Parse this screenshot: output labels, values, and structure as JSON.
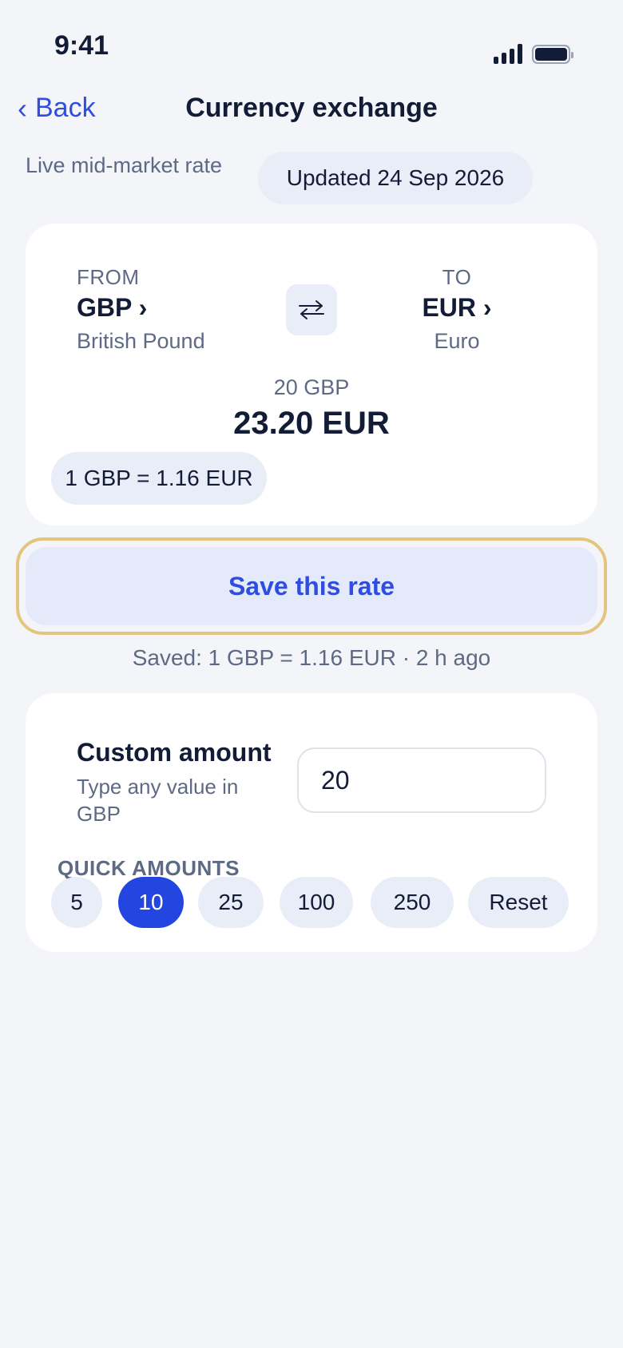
{
  "status_bar": {
    "time": "9:41"
  },
  "nav": {
    "back_label": "Back",
    "title": "Currency exchange"
  },
  "rate_info": {
    "label": "Live mid-market rate",
    "updated": "Updated 24 Sep 2026"
  },
  "converter": {
    "from": {
      "caption": "FROM",
      "code": "GBP ›",
      "name": "British Pound"
    },
    "to": {
      "caption": "TO",
      "code": "EUR ›",
      "name": "Euro"
    },
    "swap_icon": "swap-arrows-icon",
    "source_amount": "20 GBP",
    "result_amount": "23.20 EUR",
    "rate": "1 GBP = 1.16 EUR"
  },
  "save": {
    "button_label": "Save this rate",
    "saved_note": "Saved: 1 GBP = 1.16 EUR · 2 h ago"
  },
  "custom": {
    "title": "Custom amount",
    "subtitle": "Type any value in GBP",
    "input_value": "20",
    "quick_label": "QUICK AMOUNTS",
    "quick_amounts": [
      "5",
      "10",
      "25",
      "100",
      "250",
      "Reset"
    ],
    "selected": "10"
  },
  "colors": {
    "accent": "#2446e0",
    "background": "#f3f5f9",
    "highlight_outline": "#e4c57e"
  }
}
